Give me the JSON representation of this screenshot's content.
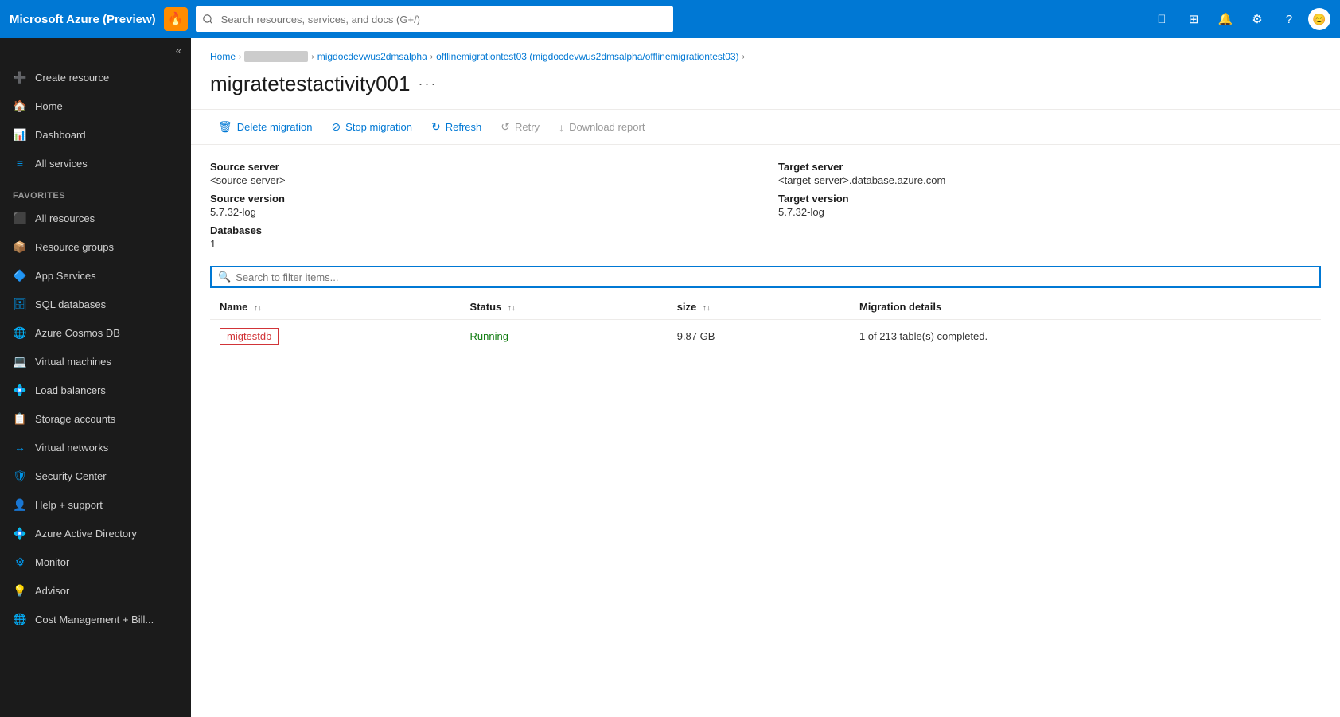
{
  "topbar": {
    "brand": "Microsoft Azure (Preview)",
    "search_placeholder": "Search resources, services, and docs (G+/)",
    "icon_char": "🔥"
  },
  "sidebar": {
    "collapse_icon": "«",
    "items": [
      {
        "id": "create-resource",
        "label": "Create resource",
        "icon": "➕",
        "color": "#0078d4"
      },
      {
        "id": "home",
        "label": "Home",
        "icon": "🏠",
        "color": "#0078d4"
      },
      {
        "id": "dashboard",
        "label": "Dashboard",
        "icon": "📊",
        "color": "#0078d4"
      },
      {
        "id": "all-services",
        "label": "All services",
        "icon": "≡",
        "color": "#0078d4"
      }
    ],
    "favorites_label": "FAVORITES",
    "favorites": [
      {
        "id": "all-resources",
        "label": "All resources",
        "icon": "⬛",
        "color": "#0078d4"
      },
      {
        "id": "resource-groups",
        "label": "Resource groups",
        "icon": "📦",
        "color": "#0078d4"
      },
      {
        "id": "app-services",
        "label": "App Services",
        "icon": "🔷",
        "color": "#0078d4"
      },
      {
        "id": "sql-databases",
        "label": "SQL databases",
        "icon": "🗄",
        "color": "#0078d4"
      },
      {
        "id": "azure-cosmos-db",
        "label": "Azure Cosmos DB",
        "icon": "🌐",
        "color": "#0078d4"
      },
      {
        "id": "virtual-machines",
        "label": "Virtual machines",
        "icon": "💻",
        "color": "#0078d4"
      },
      {
        "id": "load-balancers",
        "label": "Load balancers",
        "icon": "💠",
        "color": "#0078d4"
      },
      {
        "id": "storage-accounts",
        "label": "Storage accounts",
        "icon": "📋",
        "color": "#0078d4"
      },
      {
        "id": "virtual-networks",
        "label": "Virtual networks",
        "icon": "↔",
        "color": "#0078d4"
      },
      {
        "id": "security-center",
        "label": "Security Center",
        "icon": "🛡",
        "color": "#0078d4"
      },
      {
        "id": "help-support",
        "label": "Help + support",
        "icon": "👤",
        "color": "#0078d4"
      },
      {
        "id": "azure-ad",
        "label": "Azure Active Directory",
        "icon": "💠",
        "color": "#0078d4"
      },
      {
        "id": "monitor",
        "label": "Monitor",
        "icon": "⚙",
        "color": "#0078d4"
      },
      {
        "id": "advisor",
        "label": "Advisor",
        "icon": "💡",
        "color": "#0078d4"
      },
      {
        "id": "cost-management",
        "label": "Cost Management + Bill...",
        "icon": "🌐",
        "color": "#0078d4"
      }
    ]
  },
  "breadcrumb": {
    "items": [
      {
        "id": "home",
        "label": "Home",
        "blurred": false
      },
      {
        "id": "blurred",
        "label": "",
        "blurred": true
      },
      {
        "id": "server",
        "label": "migdocdevwus2dmsalpha",
        "blurred": false
      },
      {
        "id": "migration",
        "label": "offlinemigrationtest03 (migdocdevwus2dmsalpha/offlinemigrationtest03)",
        "blurred": false
      }
    ]
  },
  "page": {
    "title": "migratetestactivity001",
    "more_icon": "···"
  },
  "toolbar": {
    "buttons": [
      {
        "id": "delete-migration",
        "label": "Delete migration",
        "icon": "🗑"
      },
      {
        "id": "stop-migration",
        "label": "Stop migration",
        "icon": "⊘"
      },
      {
        "id": "refresh",
        "label": "Refresh",
        "icon": "↻"
      },
      {
        "id": "retry",
        "label": "Retry",
        "icon": "↺"
      },
      {
        "id": "download-report",
        "label": "Download report",
        "icon": "↓"
      }
    ]
  },
  "info": {
    "source_server_label": "Source server",
    "source_server_value": "<source-server>",
    "source_version_label": "Source version",
    "source_version_value": "5.7.32-log",
    "databases_label": "Databases",
    "databases_value": "1",
    "target_server_label": "Target server",
    "target_server_value": "<target-server>.database.azure.com",
    "target_version_label": "Target version",
    "target_version_value": "5.7.32-log"
  },
  "filter": {
    "placeholder": "Search to filter items..."
  },
  "table": {
    "columns": [
      {
        "id": "name",
        "label": "Name"
      },
      {
        "id": "status",
        "label": "Status"
      },
      {
        "id": "size",
        "label": "size"
      },
      {
        "id": "migration-details",
        "label": "Migration details"
      }
    ],
    "rows": [
      {
        "name": "migtestdb",
        "status": "Running",
        "size": "9.87 GB",
        "migration_details": "1 of 213 table(s) completed."
      }
    ]
  }
}
